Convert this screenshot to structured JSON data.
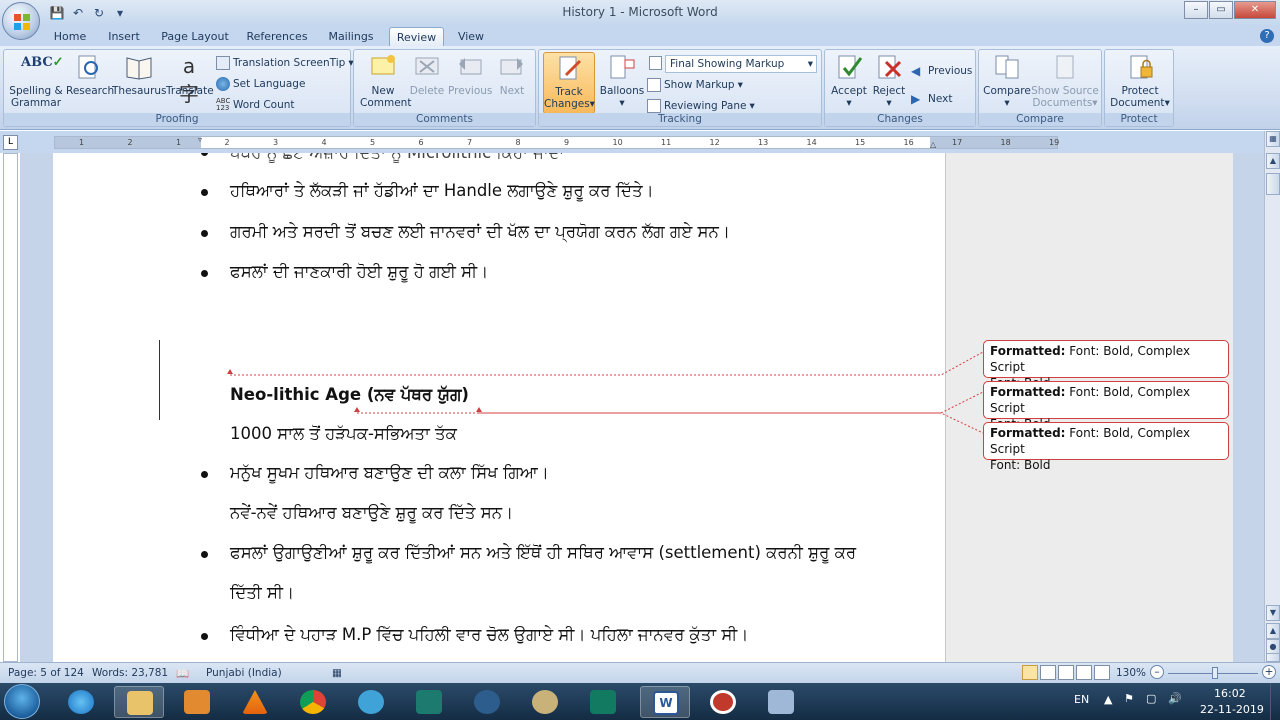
{
  "window": {
    "title": "History 1 - Microsoft Word",
    "controls": {
      "minimize": "–",
      "restore": "▭",
      "close": "✕"
    }
  },
  "quick_access": {
    "save_icon": "save-icon",
    "undo_icon": "undo-icon",
    "redo_icon": "redo-icon"
  },
  "tabs": [
    "Home",
    "Insert",
    "Page Layout",
    "References",
    "Mailings",
    "Review",
    "View"
  ],
  "active_tab": "Review",
  "ribbon": {
    "proofing": {
      "label": "Proofing",
      "spelling": "Spelling &",
      "spelling2": "Grammar",
      "research": "Research",
      "thesaurus": "Thesaurus",
      "translate": "Translate",
      "translation_screentip": "Translation ScreenTip",
      "set_language": "Set Language",
      "word_count": "Word Count"
    },
    "comments": {
      "label": "Comments",
      "new_comment": "New",
      "new_comment2": "Comment",
      "delete": "Delete",
      "previous": "Previous",
      "next": "Next"
    },
    "tracking": {
      "label": "Tracking",
      "track_changes": "Track",
      "track_changes2": "Changes",
      "balloons": "Balloons",
      "display_for_review": "Final Showing Markup",
      "show_markup": "Show Markup",
      "reviewing_pane": "Reviewing Pane"
    },
    "changes": {
      "label": "Changes",
      "accept": "Accept",
      "reject": "Reject",
      "previous": "Previous",
      "next": "Next"
    },
    "compare": {
      "label": "Compare",
      "compare": "Compare",
      "show_source": "Show Source",
      "show_source2": "Documents"
    },
    "protect": {
      "label": "Protect",
      "protect_document": "Protect",
      "protect_document2": "Document"
    }
  },
  "ruler": {
    "numbers": [
      "1",
      "2",
      "1",
      "2",
      "3",
      "4",
      "5",
      "6",
      "7",
      "8",
      "9",
      "10",
      "11",
      "12",
      "13",
      "14",
      "15",
      "16",
      "17",
      "18",
      "19"
    ]
  },
  "document": {
    "lines": {
      "partial_top": "ਪੱਥਰ ਨੂੰ ਛੋਟੇ ਔਜ਼ਾਰ ਦਿੱਤਾ ਨੂੰ Microlithic ਕਿਹਾ ਜਾਂਦਾ",
      "line1": "ਹਥਿਆਰਾਂ ਤੇ ਲੱਕੜੀ ਜਾਂ ਹੱਡੀਆਂ ਦਾ Handle ਲਗਾਉਣੇ ਸ਼ੁਰੂ ਕਰ ਦਿੱਤੇ।",
      "line2": "ਗਰਮੀ ਅਤੇ ਸਰਦੀ ਤੋਂ ਬਚਣ ਲਈ ਜਾਨਵਰਾਂ ਦੀ ਖੱਲ ਦਾ ਪ੍ਰਯੋਗ ਕਰਨ ਲੱਗ ਗਏ ਸਨ।",
      "line3": "ਫਸਲਾਂ ਦੀ ਜਾਣਕਾਰੀ ਹੋਈ ਸ਼ੁਰੂ ਹੋ ਗਈ ਸੀ।",
      "heading": "Neo-lithic Age (ਨਵ ਪੱਥਰ ਯੁੱਗ)",
      "subheading": "1000 ਸਾਲ ਤੋਂ ਹੜੱਪਕ-ਸਭਿਅਤਾ ਤੱਕ",
      "line4": "ਮਨੁੱਖ ਸੂਖਮ ਹਥਿਆਰ ਬਣਾਉਣ ਦੀ ਕਲਾ ਸਿੱਖ ਗਿਆ।",
      "line5": "ਨਵੇਂ-ਨਵੇਂ ਹਥਿਆਰ ਬਣਾਉਣੇ ਸ਼ੁਰੂ ਕਰ ਦਿੱਤੇ ਸਨ।",
      "line6": "ਫਸਲਾਂ ਉਗਾਉਣੀਆਂ ਸ਼ੁਰੂ ਕਰ ਦਿੱਤੀਆਂ ਸਨ ਅਤੇ ਇੱਥੋਂ ਹੀ ਸਥਿਰ ਆਵਾਸ (settlement) ਕਰਨੀ ਸ਼ੁਰੂ ਕਰ",
      "line6b": "ਦਿੱਤੀ ਸੀ।",
      "line7": "ਵਿੰਧੀਆ ਦੇ ਪਹਾੜ M.P ਵਿੱਚ ਪਹਿਲੀ ਵਾਰ ਚੋਲ ਉਗਾਏ ਸੀ।  ਪਹਿਲਾ ਜਾਨਵਰ ਕੁੱਤਾ ਸੀ।"
    },
    "balloons": [
      {
        "label": "Formatted:",
        "text": " Font: Bold, Complex Script",
        "text2": "Font: Bold"
      },
      {
        "label": "Formatted:",
        "text": " Font: Bold, Complex Script",
        "text2": "Font: Bold"
      },
      {
        "label": "Formatted:",
        "text": " Font: Bold, Complex Script",
        "text2": "Font: Bold"
      }
    ]
  },
  "status": {
    "page": "Page: 5 of 124",
    "words": "Words: 23,781",
    "language": "Punjabi (India)",
    "zoom": "130%"
  },
  "tray": {
    "lang": "EN",
    "time": "16:02",
    "date": "22-11-2019"
  },
  "colors": {
    "ribbon_bg": "#cfdcef",
    "track_changes_active": "#f8b95a",
    "revision_red": "#d04040"
  }
}
